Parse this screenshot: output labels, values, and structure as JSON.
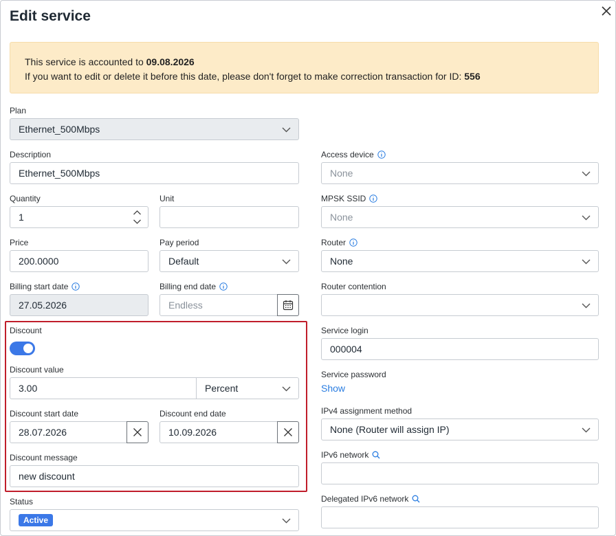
{
  "dialog": {
    "title": "Edit service"
  },
  "alert": {
    "line1_prefix": "This service is accounted to ",
    "line1_date": "09.08.2026",
    "line2_prefix": "If you want to edit or delete it before this date, please don't forget to make correction transaction for ID: ",
    "line2_id": "556"
  },
  "left": {
    "plan": {
      "label": "Plan",
      "value": "Ethernet_500Mbps"
    },
    "description": {
      "label": "Description",
      "value": "Ethernet_500Mbps"
    },
    "quantity": {
      "label": "Quantity",
      "value": "1"
    },
    "unit": {
      "label": "Unit",
      "value": ""
    },
    "price": {
      "label": "Price",
      "value": "200.0000"
    },
    "pay_period": {
      "label": "Pay period",
      "value": "Default"
    },
    "billing_start": {
      "label": "Billing start date",
      "value": "27.05.2026"
    },
    "billing_end": {
      "label": "Billing end date",
      "placeholder": "Endless"
    },
    "discount": {
      "label": "Discount",
      "enabled": true
    },
    "discount_value": {
      "label": "Discount value",
      "value": "3.00",
      "type": "Percent"
    },
    "discount_start": {
      "label": "Discount start date",
      "value": "28.07.2026"
    },
    "discount_end": {
      "label": "Discount end date",
      "value": "10.09.2026"
    },
    "discount_message": {
      "label": "Discount message",
      "value": "new discount"
    },
    "status": {
      "label": "Status",
      "value": "Active"
    }
  },
  "right": {
    "access_device": {
      "label": "Access device",
      "value": "None"
    },
    "mpsk_ssid": {
      "label": "MPSK SSID",
      "value": "None"
    },
    "router": {
      "label": "Router",
      "value": "None"
    },
    "router_contention": {
      "label": "Router contention",
      "value": ""
    },
    "service_login": {
      "label": "Service login",
      "value": "000004"
    },
    "service_password": {
      "label": "Service password",
      "action": "Show"
    },
    "ipv4_method": {
      "label": "IPv4 assignment method",
      "value": "None (Router will assign IP)"
    },
    "ipv6_network": {
      "label": "IPv6 network",
      "value": ""
    },
    "delegated_ipv6": {
      "label": "Delegated IPv6 network",
      "value": ""
    }
  },
  "colors": {
    "accent": "#3b78e7",
    "link": "#2a7de1",
    "alert_bg": "#fdebc8",
    "highlight": "#c01d2a",
    "disabled_bg": "#e9ecef"
  },
  "icons": {
    "close": "close-icon",
    "chevron": "chevron-down-icon",
    "info": "info-icon",
    "search": "search-icon",
    "calendar": "calendar-icon",
    "clear": "clear-icon",
    "stepper": "stepper-icon"
  }
}
